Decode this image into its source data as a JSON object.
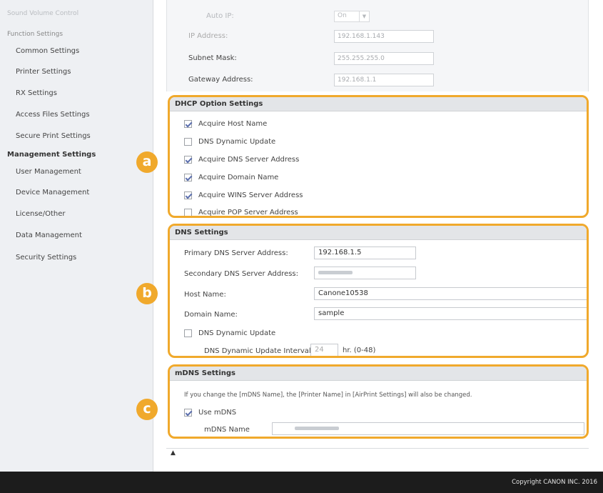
{
  "sidebar": {
    "items": [
      {
        "label": "Sound Volume Control",
        "kind": "top"
      },
      {
        "label": "Function Settings",
        "kind": "header"
      },
      {
        "label": "Common Settings",
        "kind": "item"
      },
      {
        "label": "Printer Settings",
        "kind": "item"
      },
      {
        "label": "RX Settings",
        "kind": "item"
      },
      {
        "label": "Access Files Settings",
        "kind": "item"
      },
      {
        "label": "Secure Print Settings",
        "kind": "item"
      },
      {
        "label": "Management Settings",
        "kind": "header-bold"
      },
      {
        "label": "User Management",
        "kind": "item"
      },
      {
        "label": "Device Management",
        "kind": "item"
      },
      {
        "label": "License/Other",
        "kind": "item"
      },
      {
        "label": "Data Management",
        "kind": "item"
      },
      {
        "label": "Security Settings",
        "kind": "item"
      }
    ]
  },
  "top_panel": {
    "auto_ip_label": "Auto IP:",
    "auto_ip_value": "On",
    "ip_label": "IP Address:",
    "ip_value": "192.168.1.143",
    "subnet_label": "Subnet Mask:",
    "subnet_value": "255.255.255.0",
    "gateway_label": "Gateway Address:",
    "gateway_value": "192.168.1.1"
  },
  "dhcp": {
    "badge": "a",
    "title": "DHCP Option Settings",
    "options": [
      {
        "label": "Acquire Host Name",
        "checked": true
      },
      {
        "label": "DNS Dynamic Update",
        "checked": false
      },
      {
        "label": "Acquire DNS Server Address",
        "checked": true
      },
      {
        "label": "Acquire Domain Name",
        "checked": true
      },
      {
        "label": "Acquire WINS Server Address",
        "checked": true
      },
      {
        "label": "Acquire POP Server Address",
        "checked": false
      }
    ]
  },
  "dns": {
    "badge": "b",
    "title": "DNS Settings",
    "primary_label": "Primary DNS Server Address:",
    "primary_value": "192.168.1.5",
    "secondary_label": "Secondary DNS Server Address:",
    "host_label": "Host Name:",
    "host_value": "Canone10538",
    "domain_label": "Domain Name:",
    "domain_value": "sample",
    "dynamic_update_label": "DNS Dynamic Update",
    "dynamic_update_checked": false,
    "interval_label": "DNS Dynamic Update Interval:",
    "interval_value": "24",
    "interval_unit": "hr. (0-48)"
  },
  "mdns": {
    "badge": "c",
    "title": "mDNS Settings",
    "note": "If you change the [mDNS Name], the [Printer Name] in [AirPrint Settings] will also be changed.",
    "use_label": "Use mDNS",
    "use_checked": true,
    "name_label": "mDNS Name"
  },
  "footer": {
    "scroll_top": "▲",
    "copyright": "Copyright CANON INC. 2016"
  },
  "colors": {
    "accent": "#f0a92c",
    "footer_bg": "#1c1c1c",
    "sidebar_bg": "#eef0f3"
  }
}
